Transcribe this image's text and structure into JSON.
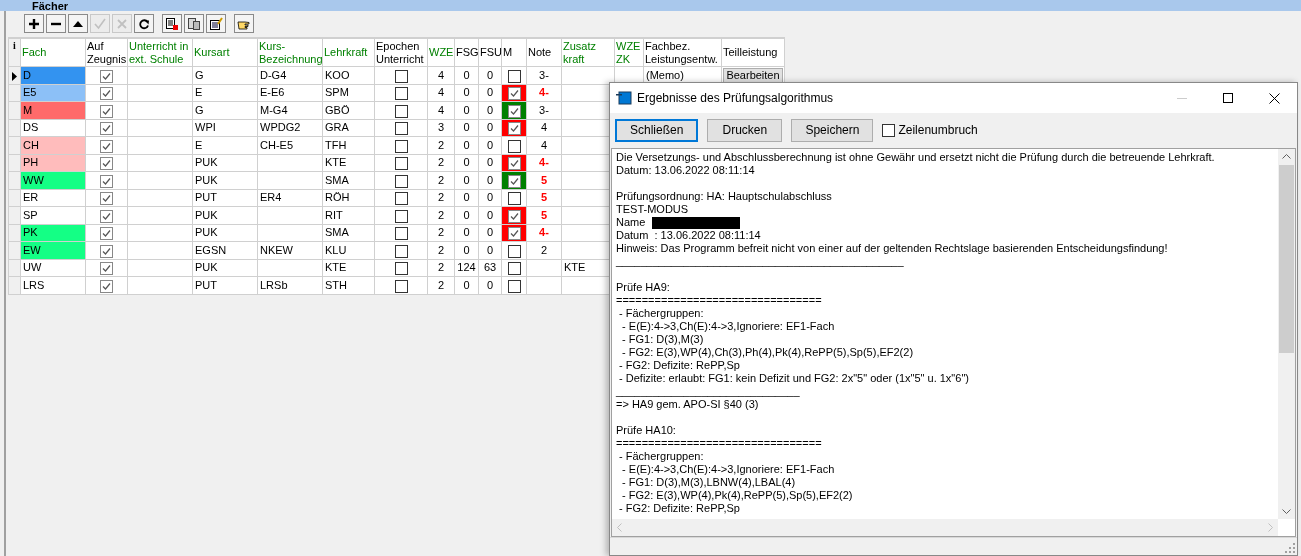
{
  "panel": {
    "title": "Fächer"
  },
  "toolbar": [
    {
      "kind": "add",
      "disabled": false
    },
    {
      "kind": "remove",
      "disabled": false
    },
    {
      "kind": "up",
      "disabled": false
    },
    {
      "kind": "confirm",
      "disabled": true
    },
    {
      "kind": "cancel",
      "disabled": true
    },
    {
      "kind": "refresh",
      "disabled": false
    },
    {
      "kind": "export",
      "disabled": false
    },
    {
      "kind": "copy",
      "disabled": false
    },
    {
      "kind": "edit",
      "disabled": false
    },
    {
      "kind": "pointer",
      "disabled": false
    }
  ],
  "table": {
    "info": "i",
    "columns": [
      {
        "label": "Fach",
        "editable": true
      },
      {
        "label": "Auf Zeugnis",
        "editable": false
      },
      {
        "label": "Unterricht in ext. Schule",
        "editable": true
      },
      {
        "label": "Kursart",
        "editable": true
      },
      {
        "label": "Kurs-Bezeichnung",
        "editable": true
      },
      {
        "label": "Lehrkraft",
        "editable": true
      },
      {
        "label": "Epochen Unterricht",
        "editable": false
      },
      {
        "label": "WZE",
        "editable": true
      },
      {
        "label": "FSG",
        "editable": false
      },
      {
        "label": "FSU",
        "editable": false
      },
      {
        "label": "M",
        "editable": false
      },
      {
        "label": "Note",
        "editable": false
      },
      {
        "label": "Zusatz kraft",
        "editable": true
      },
      {
        "label": "WZE ZK",
        "editable": true
      },
      {
        "label": "Fachbez. Leistungsentw.",
        "editable": false
      },
      {
        "label": "Teilleistung",
        "editable": false
      }
    ],
    "rows": [
      {
        "current": true,
        "fach": "D",
        "color": "#3393f0",
        "zeugnis": true,
        "ext": "",
        "kursart": "G",
        "kursbez": "D-G4",
        "lehrkraft": "KOO",
        "epochen": false,
        "wze": "4",
        "fsg": "0",
        "fsu": "0",
        "m": {
          "checked": false
        },
        "note": "3-",
        "deficit": false,
        "zusatz": "",
        "memo": "(Memo)",
        "teil": "Bearbeiten"
      },
      {
        "current": false,
        "fach": "E5",
        "color": "#8cc0f7",
        "zeugnis": true,
        "ext": "",
        "kursart": "E",
        "kursbez": "E-E6",
        "lehrkraft": "SPM",
        "epochen": false,
        "wze": "4",
        "fsg": "0",
        "fsu": "0",
        "m": {
          "checked": true,
          "color": "#ff0000"
        },
        "note": "4-",
        "deficit": true,
        "zusatz": ""
      },
      {
        "current": false,
        "fach": "M",
        "color": "#ff6a6a",
        "zeugnis": true,
        "ext": "",
        "kursart": "G",
        "kursbez": "M-G4",
        "lehrkraft": "GBÖ",
        "epochen": false,
        "wze": "4",
        "fsg": "0",
        "fsu": "0",
        "m": {
          "checked": true,
          "color": "#008000"
        },
        "note": "3-",
        "deficit": false,
        "zusatz": ""
      },
      {
        "current": false,
        "fach": "DS",
        "zeugnis": true,
        "ext": "",
        "kursart": "WPI",
        "kursbez": "WPDG2",
        "lehrkraft": "GRA",
        "epochen": false,
        "wze": "3",
        "fsg": "0",
        "fsu": "0",
        "m": {
          "checked": true,
          "color": "#ff0000"
        },
        "note": "4",
        "deficit": false,
        "zusatz": ""
      },
      {
        "current": false,
        "fach": "CH",
        "color": "#ffbcbc",
        "zeugnis": true,
        "ext": "",
        "kursart": "E",
        "kursbez": "CH-E5",
        "lehrkraft": "TFH",
        "epochen": false,
        "wze": "2",
        "fsg": "0",
        "fsu": "0",
        "m": {
          "checked": false
        },
        "note": "4",
        "deficit": false,
        "zusatz": ""
      },
      {
        "current": false,
        "fach": "PH",
        "color": "#ffbcbc",
        "zeugnis": true,
        "ext": "",
        "kursart": "PUK",
        "kursbez": "",
        "lehrkraft": "KTE",
        "epochen": false,
        "wze": "2",
        "fsg": "0",
        "fsu": "0",
        "m": {
          "checked": true,
          "color": "#ff0000"
        },
        "note": "4-",
        "deficit": true,
        "zusatz": ""
      },
      {
        "current": false,
        "fach": "WW",
        "color": "#14ff85",
        "zeugnis": true,
        "ext": "",
        "kursart": "PUK",
        "kursbez": "",
        "lehrkraft": "SMA",
        "epochen": false,
        "wze": "2",
        "fsg": "0",
        "fsu": "0",
        "m": {
          "checked": true,
          "color": "#008000"
        },
        "note": "5",
        "deficit": true,
        "zusatz": ""
      },
      {
        "current": false,
        "fach": "ER",
        "zeugnis": true,
        "ext": "",
        "kursart": "PUT",
        "kursbez": "ER4",
        "lehrkraft": "RÖH",
        "epochen": false,
        "wze": "2",
        "fsg": "0",
        "fsu": "0",
        "m": {
          "checked": false
        },
        "note": "5",
        "deficit": true,
        "zusatz": ""
      },
      {
        "current": false,
        "fach": "SP",
        "zeugnis": true,
        "ext": "",
        "kursart": "PUK",
        "kursbez": "",
        "lehrkraft": "RIT",
        "epochen": false,
        "wze": "2",
        "fsg": "0",
        "fsu": "0",
        "m": {
          "checked": true,
          "color": "#ff0000"
        },
        "note": "5",
        "deficit": true,
        "zusatz": ""
      },
      {
        "current": false,
        "fach": "PK",
        "color": "#14ff85",
        "zeugnis": true,
        "ext": "",
        "kursart": "PUK",
        "kursbez": "",
        "lehrkraft": "SMA",
        "epochen": false,
        "wze": "2",
        "fsg": "0",
        "fsu": "0",
        "m": {
          "checked": true,
          "color": "#ff0000"
        },
        "note": "4-",
        "deficit": true,
        "zusatz": ""
      },
      {
        "current": false,
        "fach": "EW",
        "color": "#14ff85",
        "zeugnis": true,
        "ext": "",
        "kursart": "EGSN",
        "kursbez": "NKEW",
        "lehrkraft": "KLU",
        "epochen": false,
        "wze": "2",
        "fsg": "0",
        "fsu": "0",
        "m": {
          "checked": false
        },
        "note": "2",
        "deficit": false,
        "zusatz": ""
      },
      {
        "current": false,
        "fach": "UW",
        "zeugnis": true,
        "ext": "",
        "kursart": "PUK",
        "kursbez": "",
        "lehrkraft": "KTE",
        "epochen": false,
        "wze": "2",
        "fsg": "124",
        "fsu": "63",
        "m": {
          "checked": false
        },
        "note": "",
        "zusatz": "KTE"
      },
      {
        "current": false,
        "fach": "LRS",
        "zeugnis": true,
        "ext": "",
        "kursart": "PUT",
        "kursbez": "LRSb",
        "lehrkraft": "STH",
        "epochen": false,
        "wze": "2",
        "fsg": "0",
        "fsu": "0",
        "m": {
          "checked": false
        },
        "note": "",
        "zusatz": ""
      }
    ]
  },
  "dialog": {
    "title": "Ergebnisse des Prüfungsalgorithmus",
    "buttons": [
      {
        "label": "Schließen",
        "selected": true
      },
      {
        "label": "Drucken",
        "selected": false
      },
      {
        "label": "Speichern",
        "selected": false
      }
    ],
    "wrap": {
      "label": "Zeilenumbruch",
      "checked": false
    },
    "lines": [
      {
        "kind": "text",
        "text": "Die Versetzungs- und Abschlussberechnung ist ohne Gewähr und ersetzt nicht die Prüfung durch die betreuende Lehrkraft."
      },
      {
        "kind": "text",
        "text": "Datum: 13.06.2022 08:11:14"
      },
      {
        "kind": "blank"
      },
      {
        "kind": "text",
        "text": "Prüfungsordnung: HA: Hauptschulabschluss"
      },
      {
        "kind": "text",
        "text": "TEST-MODUS"
      },
      {
        "kind": "redacted",
        "text": "Name"
      },
      {
        "kind": "text",
        "text": "Datum  : 13.06.2022 08:11:14"
      },
      {
        "kind": "text",
        "text": "Hinweis: Das Programm befreit nicht von einer auf der geltenden Rechtslage basierenden Entscheidungsfindung!"
      },
      {
        "kind": "text",
        "text": "_______________________________________________"
      },
      {
        "kind": "blank"
      },
      {
        "kind": "text",
        "text": "Prüfe HA9:"
      },
      {
        "kind": "text",
        "text": "================================"
      },
      {
        "kind": "text",
        "text": " - Fächergruppen:"
      },
      {
        "kind": "text",
        "text": "  - E(E):4->3,Ch(E):4->3,Ignoriere: EF1-Fach"
      },
      {
        "kind": "text",
        "text": "  - FG1: D(3),M(3)"
      },
      {
        "kind": "text",
        "text": "  - FG2: E(3),WP(4),Ch(3),Ph(4),Pk(4),RePP(5),Sp(5),EF2(2)"
      },
      {
        "kind": "text",
        "text": " - FG2: Defizite: RePP,Sp"
      },
      {
        "kind": "text",
        "text": " - Defizite: erlaubt: FG1: kein Defizit und FG2: 2x\"5\" oder (1x\"5\" u. 1x\"6\")"
      },
      {
        "kind": "text",
        "text": "______________________________"
      },
      {
        "kind": "text",
        "text": "=> HA9 gem. APO-SI §40 (3)"
      },
      {
        "kind": "blank"
      },
      {
        "kind": "text",
        "text": "Prüfe HA10:"
      },
      {
        "kind": "text",
        "text": "================================"
      },
      {
        "kind": "text",
        "text": " - Fächergruppen:"
      },
      {
        "kind": "text",
        "text": "  - E(E):4->3,Ch(E):4->3,Ignoriere: EF1-Fach"
      },
      {
        "kind": "text",
        "text": "  - FG1: D(3),M(3),LBNW(4),LBAL(4)"
      },
      {
        "kind": "text",
        "text": "  - FG2: E(3),WP(4),Pk(4),RePP(5),Sp(5),EF2(2)"
      },
      {
        "kind": "text",
        "text": " - FG2: Defizite: RePP,Sp"
      }
    ]
  }
}
